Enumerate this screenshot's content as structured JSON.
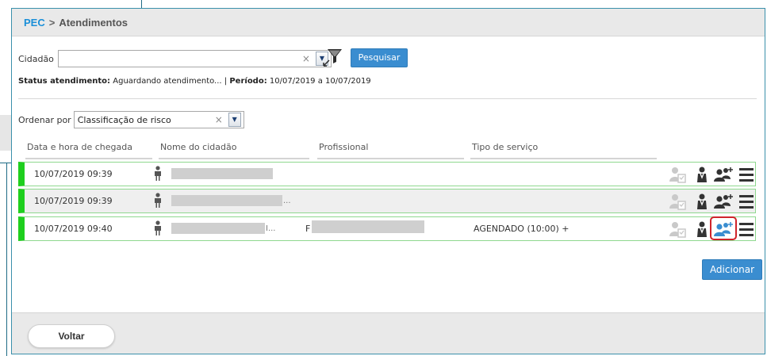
{
  "breadcrumb": {
    "root": "PEC",
    "separator": ">",
    "current": "Atendimentos"
  },
  "filter": {
    "citizen_label": "Cidadão",
    "citizen_value": "",
    "clear_glyph": "×",
    "search_button": "Pesquisar"
  },
  "status": {
    "status_label": "Status atendimento:",
    "status_value": "Aguardando atendimento...",
    "separator": "|",
    "period_label": "Período:",
    "period_value": "10/07/2019 a 10/07/2019"
  },
  "order": {
    "label": "Ordenar por",
    "value": "Classificação de risco"
  },
  "table": {
    "headers": {
      "arrival": "Data e hora de chegada",
      "citizen": "Nome do cidadão",
      "professional": "Profissional",
      "service": "Tipo de serviço"
    },
    "rows": [
      {
        "arrival": "10/07/2019 09:39",
        "citizen_suffix": "",
        "professional": "",
        "service": ""
      },
      {
        "arrival": "10/07/2019 09:39",
        "citizen_suffix": "...",
        "professional": "",
        "service": ""
      },
      {
        "arrival": "10/07/2019 09:40",
        "citizen_suffix": "I...",
        "professional": "F",
        "service": "AGENDADO (10:00) +"
      }
    ]
  },
  "actions": {
    "add_button": "Adicionar",
    "back_button": "Voltar"
  },
  "icons": [
    "person-standing-icon",
    "user-clipboard-icon",
    "doctor-icon",
    "group-add-icon",
    "hamburger-menu-icon",
    "filter-icon"
  ],
  "colors": {
    "link": "#1a8fd8",
    "primary_button": "#3a8dd0",
    "risk_green": "#1ecf1e",
    "highlight_red": "#d0242b"
  }
}
